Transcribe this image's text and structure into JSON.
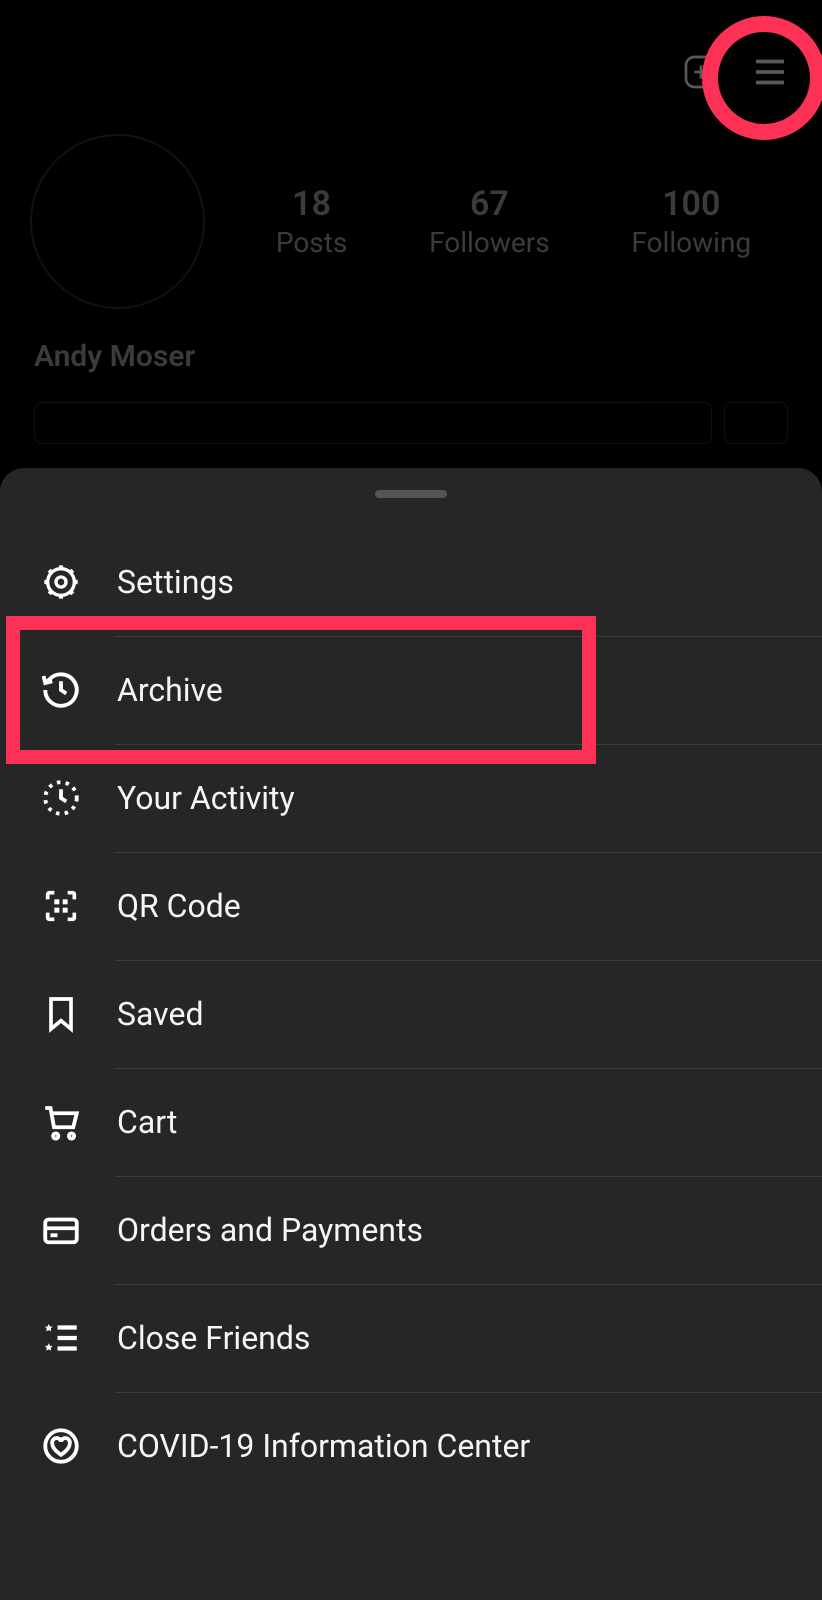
{
  "profile": {
    "display_name": "Andy Moser",
    "stats": {
      "posts": {
        "count": "18",
        "label": "Posts"
      },
      "followers": {
        "count": "67",
        "label": "Followers"
      },
      "following": {
        "count": "100",
        "label": "Following"
      }
    }
  },
  "menu": {
    "items": [
      {
        "id": "settings",
        "label": "Settings",
        "icon": "gear"
      },
      {
        "id": "archive",
        "label": "Archive",
        "icon": "history"
      },
      {
        "id": "activity",
        "label": "Your Activity",
        "icon": "activity-clock"
      },
      {
        "id": "qrcode",
        "label": "QR Code",
        "icon": "qr"
      },
      {
        "id": "saved",
        "label": "Saved",
        "icon": "bookmark"
      },
      {
        "id": "cart",
        "label": "Cart",
        "icon": "cart"
      },
      {
        "id": "orders",
        "label": "Orders and Payments",
        "icon": "card"
      },
      {
        "id": "close-friends",
        "label": "Close Friends",
        "icon": "star-list"
      },
      {
        "id": "covid",
        "label": "COVID-19 Information Center",
        "icon": "heart-badge"
      }
    ]
  },
  "annotations": {
    "highlight_color": "#fd3056"
  }
}
